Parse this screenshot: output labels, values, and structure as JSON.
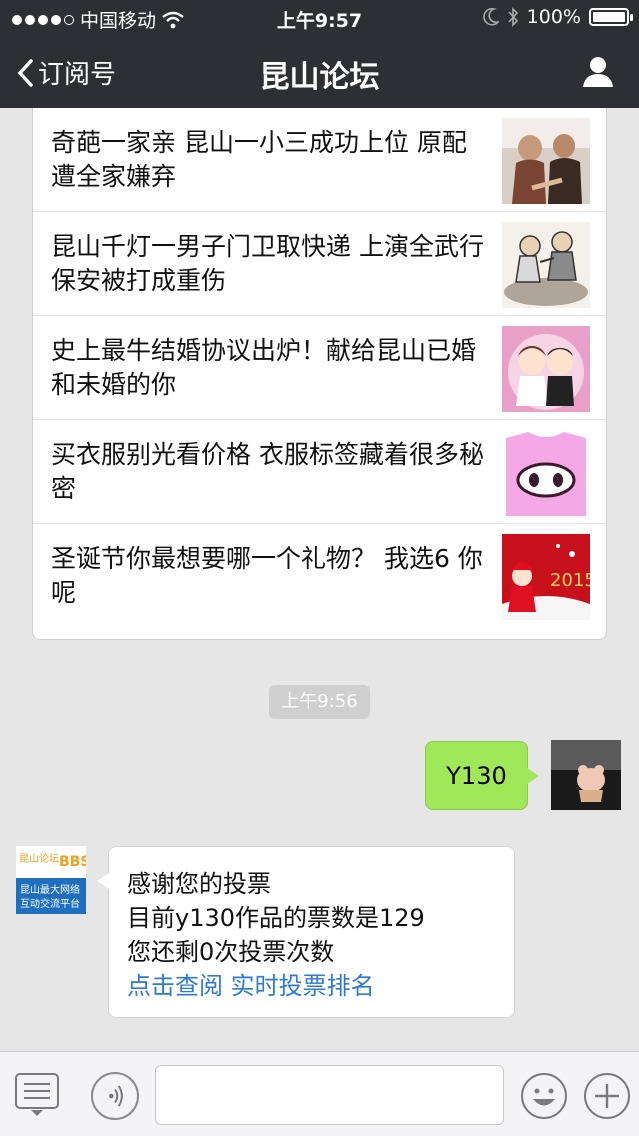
{
  "status_bar": {
    "carrier": "中国移动",
    "time": "上午9:57",
    "battery_text": "100%",
    "battery_level": 1.0,
    "signal_bars": 4
  },
  "nav": {
    "back_label": "订阅号",
    "title": "昆山论坛"
  },
  "articles": [
    {
      "title": "奇葩一家亲 昆山一小三成功上位 原配遭全家嫌弃",
      "thumb_icon": "couple-photo"
    },
    {
      "title": "昆山千灯一男子门卫取快递 上演全武行 保安被打成重伤",
      "thumb_icon": "cartoon-fight"
    },
    {
      "title": "史上最牛结婚协议出炉！献给昆山已婚和未婚的你",
      "thumb_icon": "cartoon-bride-groom"
    },
    {
      "title": "买衣服别光看价格 衣服标签藏着很多秘密",
      "thumb_icon": "pink-pig-shirt"
    },
    {
      "title": "圣诞节你最想要哪一个礼物？ 我选6 你呢",
      "thumb_icon": "christmas-card"
    }
  ],
  "timestamp": "上午9:56",
  "outgoing": {
    "text": "Y130"
  },
  "incoming": {
    "avatar_text": {
      "line1": "昆山论坛",
      "line2": "BBS",
      "line3": "昆山最大网络",
      "line4": "互动交流平台"
    },
    "line1": "感谢您的投票",
    "line2": "目前y130作品的票数是129",
    "line3": "您还剩0次投票次数",
    "link1": "点击查阅",
    "link2": "实时投票排名"
  },
  "input_bar": {
    "placeholder": ""
  },
  "colors": {
    "topbar": "#2e2f33",
    "background": "#e6e6e6",
    "outgoing_bubble": "#a0e75a",
    "link": "#2e7bcf"
  }
}
